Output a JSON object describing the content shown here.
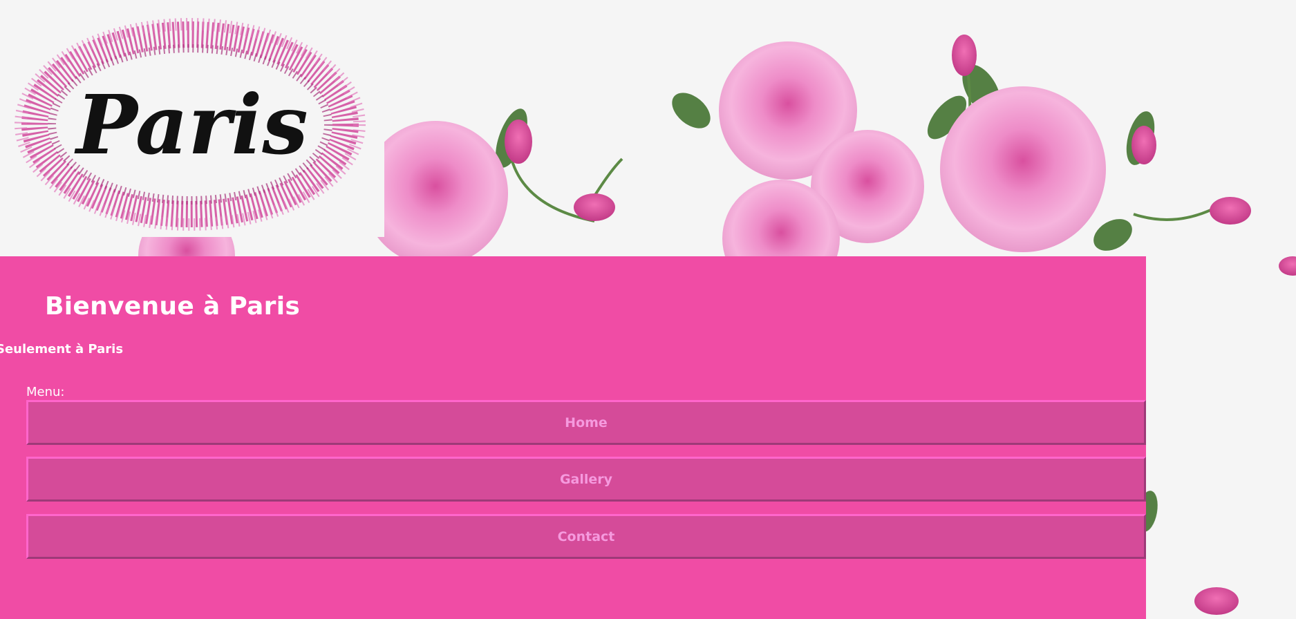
{
  "logo": {
    "text": "Paris"
  },
  "header": {
    "title": "Bienvenue à Paris",
    "subtitle": "Seulement à Paris"
  },
  "menu": {
    "label": "Menu:",
    "items": [
      {
        "label": "Home"
      },
      {
        "label": "Gallery"
      },
      {
        "label": "Contact"
      }
    ]
  },
  "colors": {
    "panel": "#f04ca5",
    "button": "#d54b99",
    "button_text": "#f59ade",
    "page_background": "#f5f5f5",
    "rose": "#f3a6d6"
  }
}
